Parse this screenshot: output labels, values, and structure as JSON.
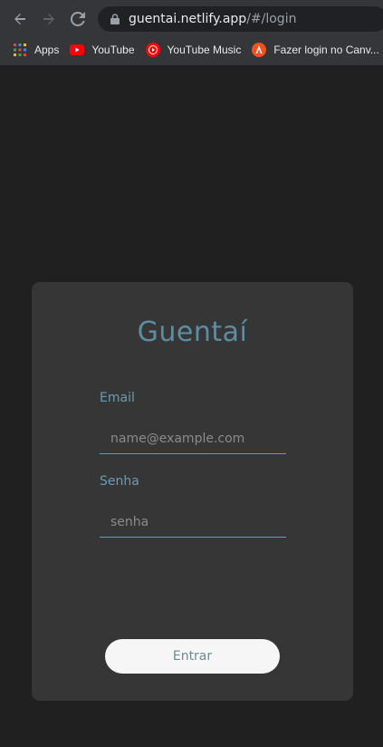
{
  "browser": {
    "url_host": "guentai.netlify.app",
    "url_path": "/#/login",
    "bookmarks": [
      {
        "label": "Apps",
        "icon": "apps-grid-icon"
      },
      {
        "label": "YouTube",
        "icon": "youtube-icon"
      },
      {
        "label": "YouTube Music",
        "icon": "youtube-music-icon"
      },
      {
        "label": "Fazer login no Canv...",
        "icon": "canvas-icon"
      }
    ]
  },
  "login": {
    "title": "Guentaí",
    "email_label": "Email",
    "email_placeholder": "name@example.com",
    "password_label": "Senha",
    "password_placeholder": "senha",
    "submit_label": "Entrar"
  },
  "colors": {
    "page_background": "#202020",
    "card_background": "#363636",
    "accent": "#5d8da3",
    "button_background": "#f6f6f6"
  }
}
